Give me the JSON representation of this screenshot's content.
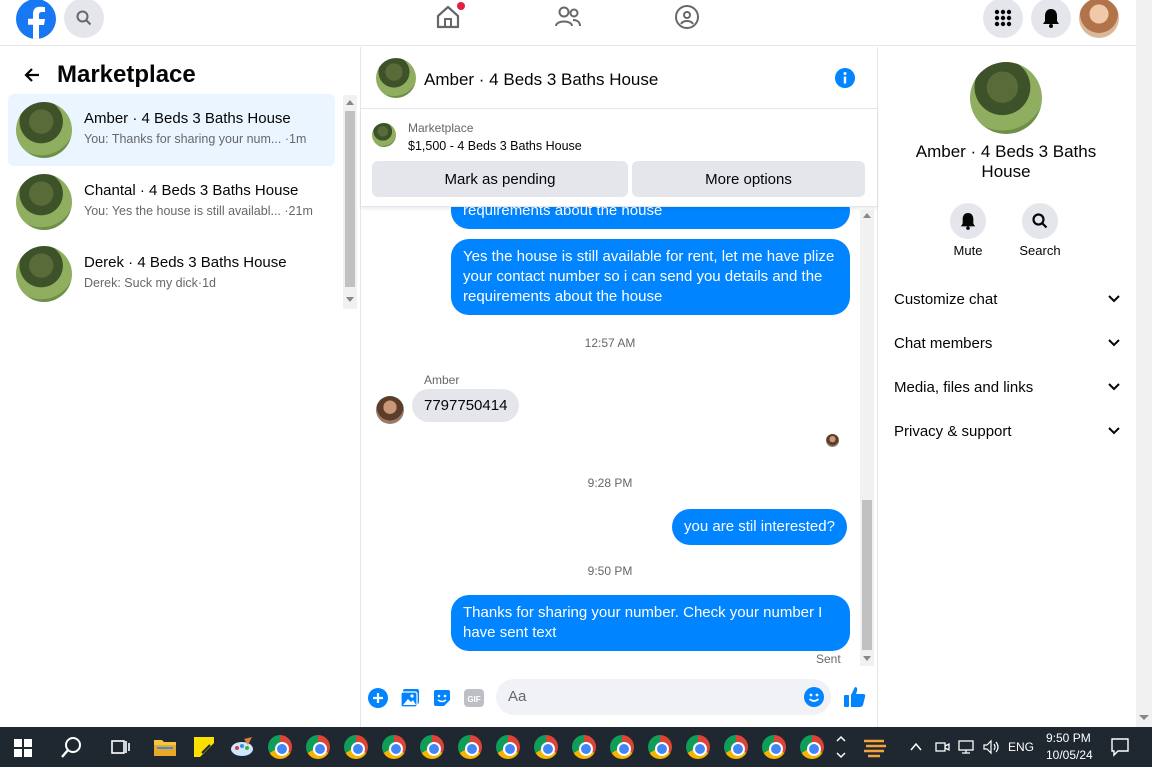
{
  "topbar": {
    "logo": "facebook-logo",
    "icons": [
      "search-icon",
      "home-icon",
      "friends-icon",
      "groups-icon",
      "menu-grid-icon",
      "bell-icon",
      "profile-avatar"
    ]
  },
  "left": {
    "title": "Marketplace",
    "conversations": [
      {
        "title": "Amber · 4 Beds 3 Baths House",
        "preview": "You: Thanks for sharing your num...",
        "time": "·1m",
        "active": true
      },
      {
        "title": "Chantal · 4 Beds 3 Baths House",
        "preview": "You: Yes the house is still availabl...",
        "time": "·21m",
        "active": false
      },
      {
        "title": "Derek · 4 Beds 3 Baths House",
        "preview": "Derek: Suck my dick",
        "time": "·1d",
        "active": false
      }
    ]
  },
  "chat": {
    "header_title": "Amber · 4 Beds 3 Baths House",
    "listing_label": "Marketplace",
    "listing_desc": "$1,500 - 4 Beds 3 Baths House",
    "mark_pending": "Mark as pending",
    "more_options": "More options",
    "msg_partial": "requirements about the house",
    "msg_available": "Yes the house is still available  for rent, let me have plize your contact number so i can send you details and the requirements about the house",
    "time1": "12:57 AM",
    "sender_name": "Amber",
    "msg_number": "7797750414",
    "time2": "9:28 PM",
    "msg_interested": "you are stil  interested?",
    "time3": "9:50 PM",
    "msg_thanks": "Thanks for sharing your number.  Check your number I have sent text",
    "sent_label": "Sent",
    "input_placeholder": "Aa"
  },
  "right": {
    "title": "Amber · 4 Beds 3 Baths House",
    "mute": "Mute",
    "search": "Search",
    "menu": [
      "Customize chat",
      "Chat members",
      "Media, files and links",
      "Privacy & support"
    ]
  },
  "taskbar": {
    "lang": "ENG",
    "time": "9:50 PM",
    "date": "10/05/24"
  },
  "colors": {
    "accent": "#0084ff",
    "fb_blue": "#1877f2",
    "taskbar": "#1f2730"
  }
}
